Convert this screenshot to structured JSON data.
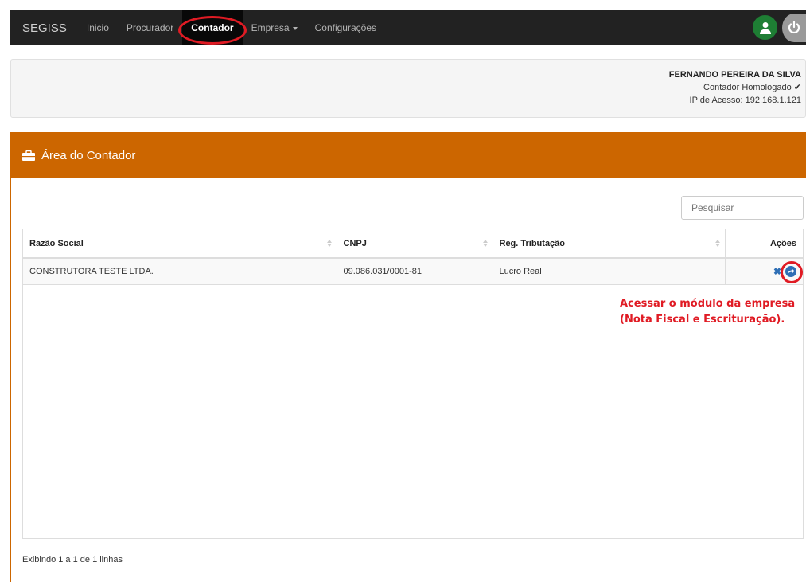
{
  "navbar": {
    "brand": "SEGISS",
    "items": [
      {
        "label": "Inicio"
      },
      {
        "label": "Procurador"
      },
      {
        "label": "Contador"
      },
      {
        "label": "Empresa"
      },
      {
        "label": "Configurações"
      }
    ],
    "active_item": "Contador",
    "user_icon": "user-icon",
    "power_icon": "power-icon"
  },
  "user_info": {
    "name": "FERNANDO PEREIRA DA SILVA",
    "role": "Contador Homologado ✔",
    "ip": "IP de Acesso: 192.168.1.121"
  },
  "panel": {
    "icon": "briefcase-icon",
    "title": "Área do Contador",
    "search_placeholder": "Pesquisar"
  },
  "table": {
    "columns": [
      "Razão Social",
      "CNPJ",
      "Reg. Tributação",
      "Ações"
    ],
    "rows": [
      {
        "razao_social": "CONSTRUTORA TESTE LTDA.",
        "cnpj": "09.086.031/0001-81",
        "reg_tributacao": "Lucro Real"
      }
    ],
    "footer": "Exibindo 1 a 1 de 1 linhas"
  },
  "annotation": {
    "line1": "Acessar o módulo da empresa",
    "line2": "(Nota Fiscal e Escrituração)."
  },
  "colors": {
    "navbar": "#222222",
    "panel_heading": "#cc6600",
    "annotation": "#e01b24",
    "action": "#2f6fb5",
    "user_button": "#1e7e34"
  }
}
